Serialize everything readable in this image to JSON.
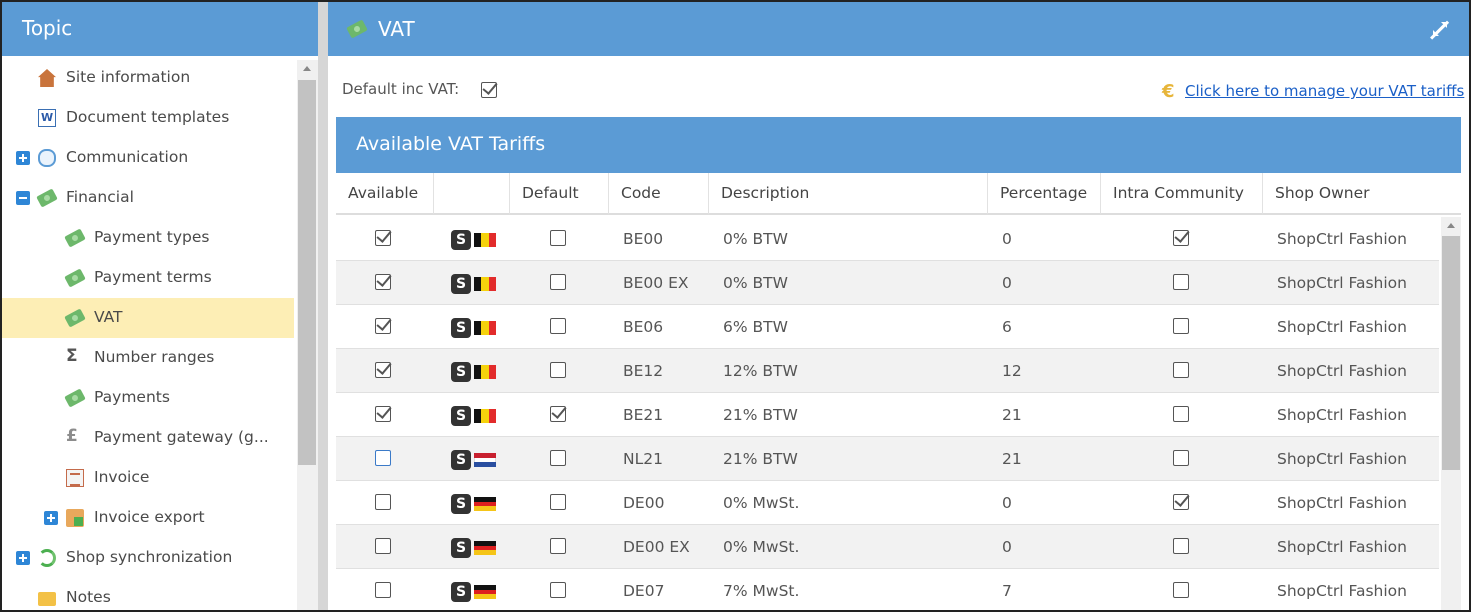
{
  "left_panel": {
    "title": "Topic",
    "items": [
      {
        "label": "Site information",
        "icon": "house-icon"
      },
      {
        "label": "Document templates",
        "icon": "document-icon"
      },
      {
        "label": "Communication",
        "icon": "speech-bubble-icon",
        "expander": "plus"
      },
      {
        "label": "Financial",
        "icon": "money-icon",
        "expander": "minus"
      },
      {
        "label": "Payment types",
        "icon": "money-icon"
      },
      {
        "label": "Payment terms",
        "icon": "money-icon"
      },
      {
        "label": "VAT",
        "icon": "money-icon",
        "selected": true
      },
      {
        "label": "Number ranges",
        "icon": "sigma-icon"
      },
      {
        "label": "Payments",
        "icon": "money-icon"
      },
      {
        "label": "Payment gateway (g...",
        "icon": "pound-icon"
      },
      {
        "label": "Invoice",
        "icon": "invoice-icon"
      },
      {
        "label": "Invoice export",
        "icon": "invoice-export-icon",
        "expander": "plus"
      },
      {
        "label": "Shop synchronization",
        "icon": "sync-icon",
        "expander": "plus"
      },
      {
        "label": "Notes",
        "icon": "notes-icon"
      }
    ]
  },
  "right_panel": {
    "title": "VAT",
    "default_inc_vat_label": "Default inc VAT:",
    "default_inc_vat_checked": true,
    "manage_link": "Click here to manage your VAT tariffs",
    "grid_title": "Available VAT Tariffs",
    "columns": [
      "Available",
      "",
      "Default",
      "Code",
      "Description",
      "Percentage",
      "Intra Community",
      "Shop Owner"
    ],
    "rows": [
      {
        "available": true,
        "country": "be",
        "default": false,
        "code": "BE00",
        "description": "0% BTW",
        "percentage": "0",
        "intra": true,
        "owner": "ShopCtrl Fashion"
      },
      {
        "available": true,
        "country": "be",
        "default": false,
        "code": "BE00 EX",
        "description": "0% BTW",
        "percentage": "0",
        "intra": false,
        "owner": "ShopCtrl Fashion"
      },
      {
        "available": true,
        "country": "be",
        "default": false,
        "code": "BE06",
        "description": "6% BTW",
        "percentage": "6",
        "intra": false,
        "owner": "ShopCtrl Fashion"
      },
      {
        "available": true,
        "country": "be",
        "default": false,
        "code": "BE12",
        "description": "12% BTW",
        "percentage": "12",
        "intra": false,
        "owner": "ShopCtrl Fashion"
      },
      {
        "available": true,
        "country": "be",
        "default": true,
        "code": "BE21",
        "description": "21% BTW",
        "percentage": "21",
        "intra": false,
        "owner": "ShopCtrl Fashion"
      },
      {
        "available": false,
        "country": "nl",
        "default": false,
        "code": "NL21",
        "description": "21% BTW",
        "percentage": "21",
        "intra": false,
        "owner": "ShopCtrl Fashion",
        "focused": true
      },
      {
        "available": false,
        "country": "de",
        "default": false,
        "code": "DE00",
        "description": "0% MwSt.",
        "percentage": "0",
        "intra": true,
        "owner": "ShopCtrl Fashion"
      },
      {
        "available": false,
        "country": "de",
        "default": false,
        "code": "DE00 EX",
        "description": "0% MwSt.",
        "percentage": "0",
        "intra": false,
        "owner": "ShopCtrl Fashion"
      },
      {
        "available": false,
        "country": "de",
        "default": false,
        "code": "DE07",
        "description": "7% MwSt.",
        "percentage": "7",
        "intra": false,
        "owner": "ShopCtrl Fashion"
      }
    ]
  },
  "colors": {
    "header_blue": "#5b9bd5",
    "selected_row": "#fdeeb5",
    "link": "#1a5fc7"
  }
}
